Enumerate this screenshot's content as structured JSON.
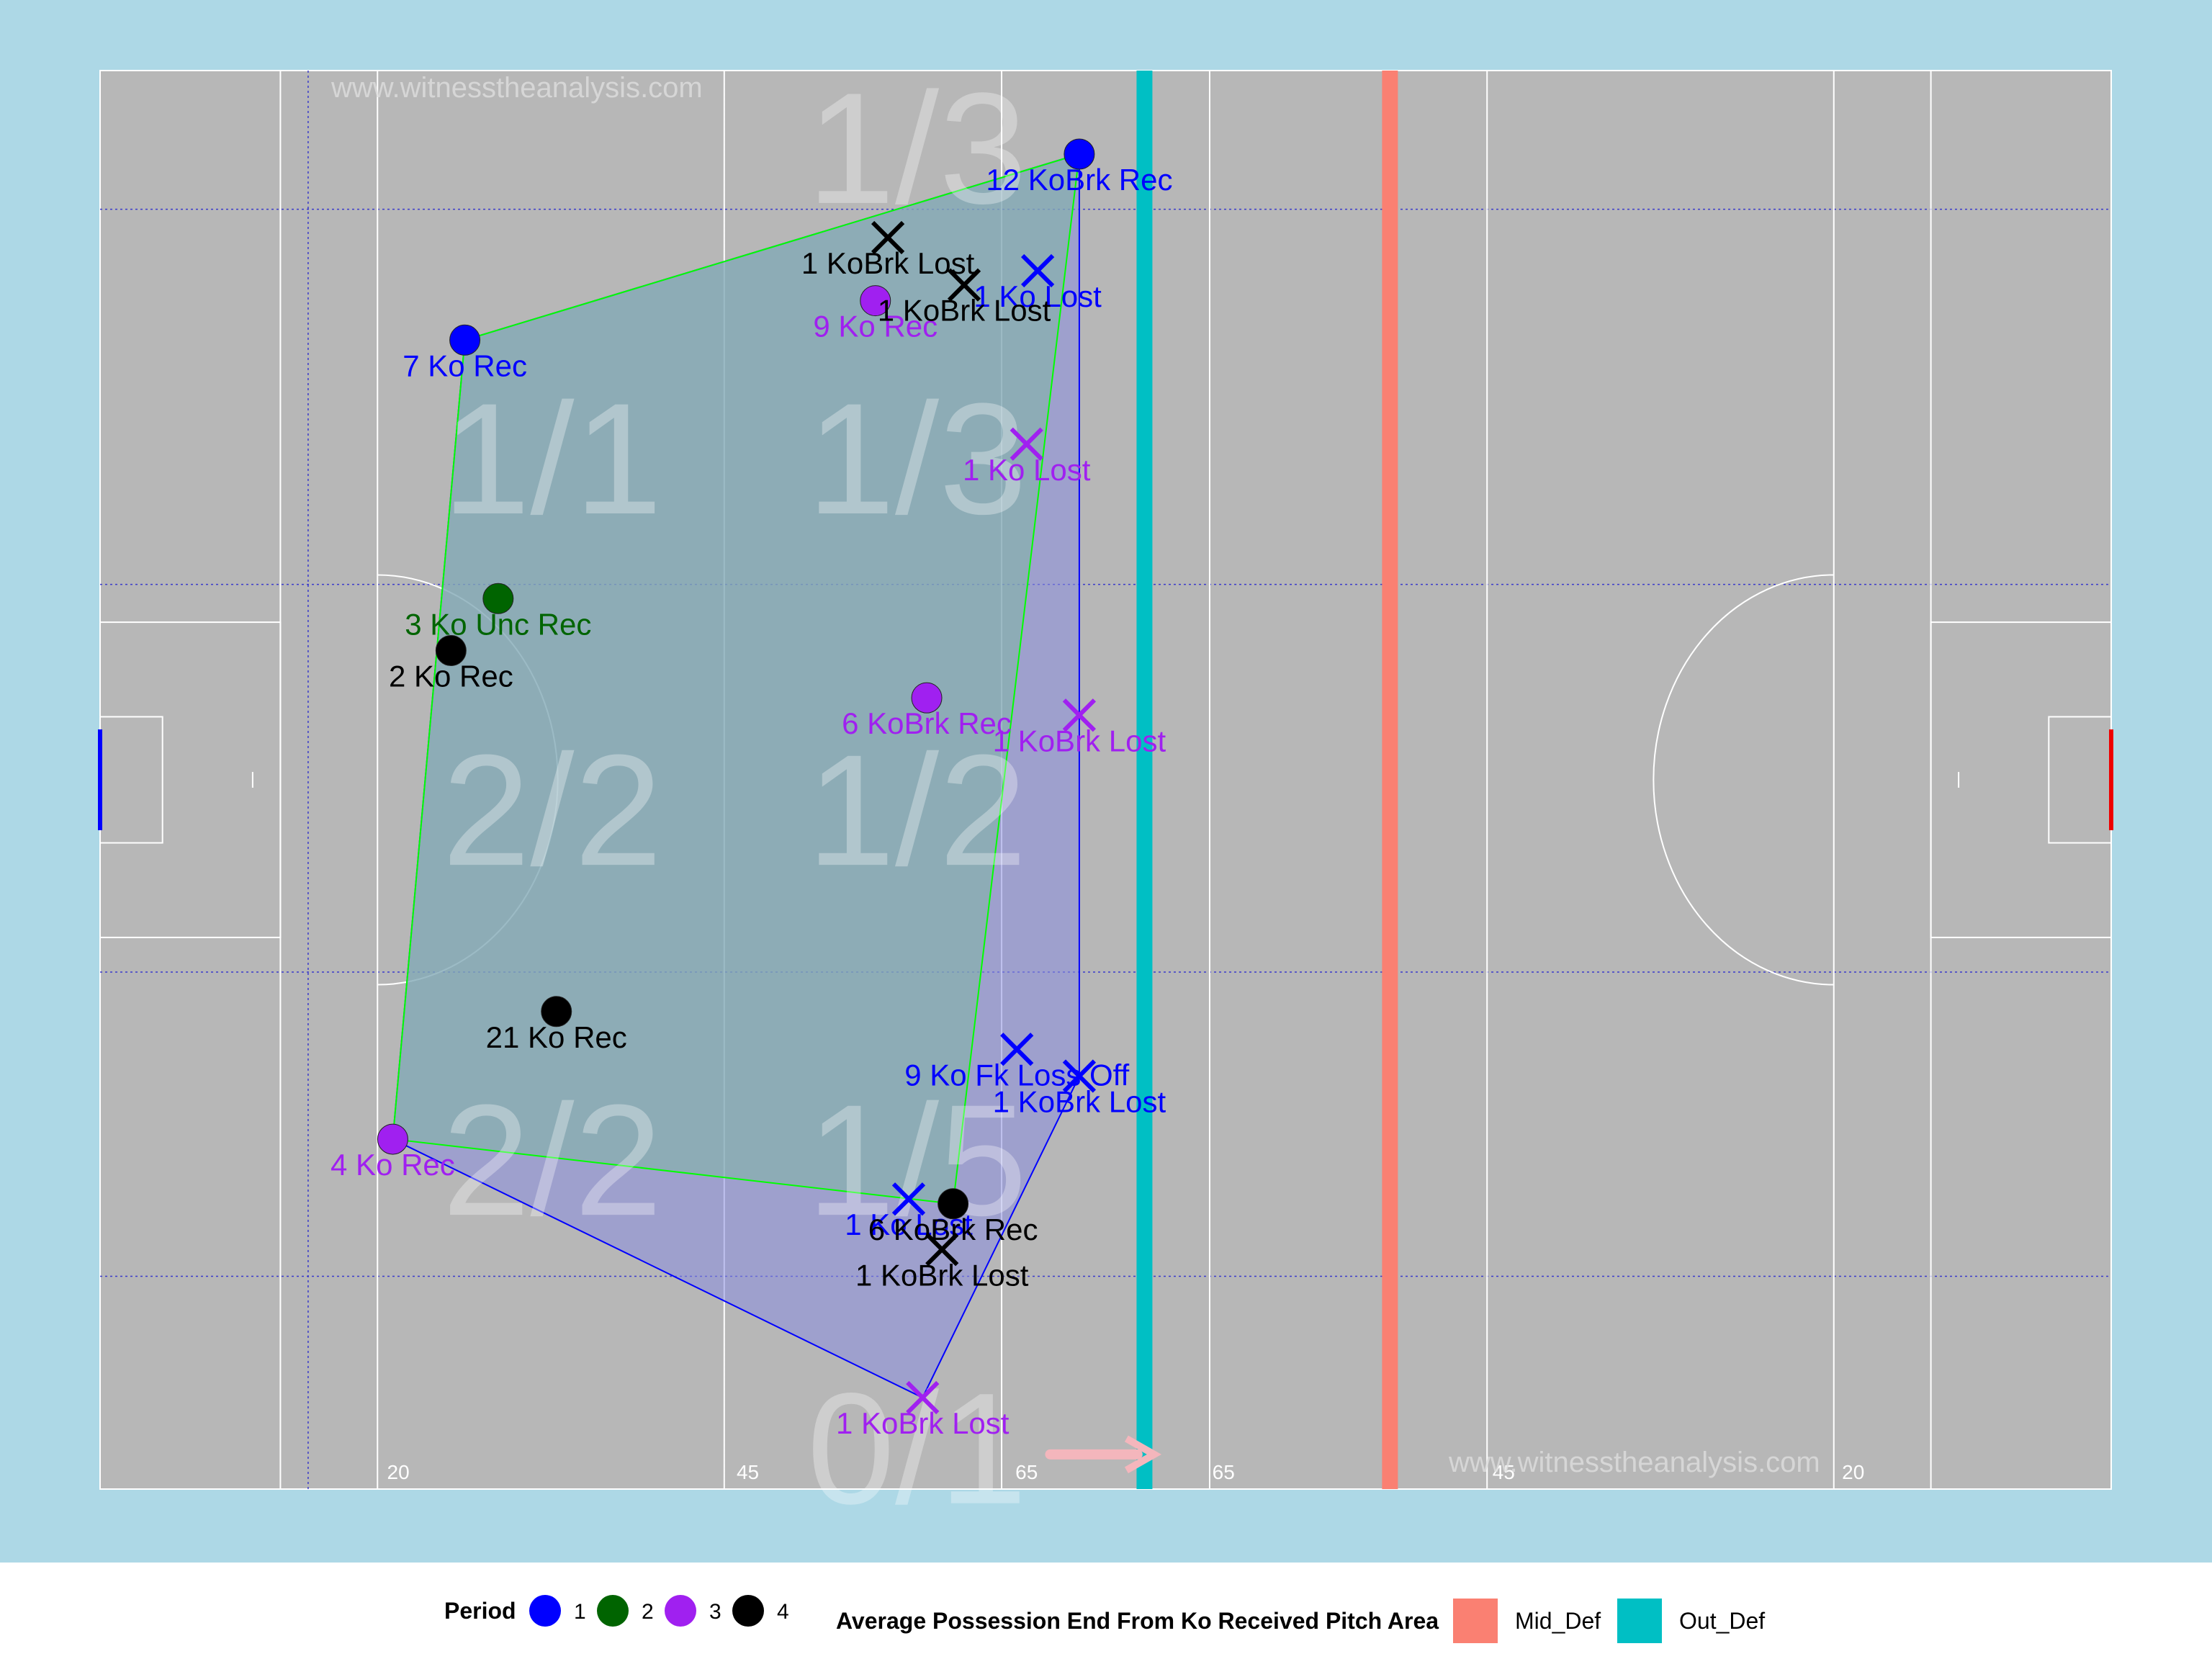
{
  "watermarks": [
    "www.witnesstheanalysis.com",
    "www.witnesstheanalysis.com"
  ],
  "colors": {
    "panel_background": "#add8e6",
    "pitch": "#b7b7b7",
    "period_1": "#0000ff",
    "period_2": "#006400",
    "period_3": "#a020f0",
    "period_4": "#000000",
    "mid_def": "#fa8072",
    "out_def": "#00bfc4",
    "hull_green_outline": "#00ff00",
    "hull_blue_outline": "#0000ff"
  },
  "chart_data": {
    "type": "scatter",
    "x_range": [
      0,
      145
    ],
    "y_range": [
      0,
      90
    ],
    "x_ticks": [
      {
        "x": 21.5,
        "label": "20"
      },
      {
        "x": 46.7,
        "label": "45"
      },
      {
        "x": 66.8,
        "label": "65"
      },
      {
        "x": 81.0,
        "label": "65"
      },
      {
        "x": 101.2,
        "label": "45"
      },
      {
        "x": 126.4,
        "label": "20"
      }
    ],
    "zone_labels": [
      {
        "x": 58.9,
        "y": 84.8,
        "label": "1/3"
      },
      {
        "x": 32.6,
        "y": 65.1,
        "label": "1/1"
      },
      {
        "x": 58.9,
        "y": 65.1,
        "label": "1/3"
      },
      {
        "x": 32.6,
        "y": 42.8,
        "label": "2/2"
      },
      {
        "x": 58.9,
        "y": 42.8,
        "label": "1/2"
      },
      {
        "x": 32.6,
        "y": 20.6,
        "label": "2/2"
      },
      {
        "x": 58.9,
        "y": 20.6,
        "label": "1/5"
      },
      {
        "x": 58.9,
        "y": 2.3,
        "label": "0/1"
      }
    ],
    "average_lines": [
      {
        "name": "Mid_Def",
        "x": 93.0,
        "color": "#fa8072"
      },
      {
        "name": "Out_Def",
        "x": 75.3,
        "color": "#00bfc4"
      }
    ],
    "points": [
      {
        "x": 70.6,
        "y": 84.7,
        "period": 1,
        "marker": "dot",
        "label": "12 KoBrk Rec"
      },
      {
        "x": 26.3,
        "y": 72.9,
        "period": 1,
        "marker": "dot",
        "label": "7 Ko Rec"
      },
      {
        "x": 67.6,
        "y": 77.3,
        "period": 1,
        "marker": "x",
        "label": "1 Ko Lost"
      },
      {
        "x": 66.1,
        "y": 27.9,
        "period": 1,
        "marker": "x",
        "label": "9 Ko Fk Loss Off"
      },
      {
        "x": 70.6,
        "y": 26.2,
        "period": 1,
        "marker": "x",
        "label": "1 KoBrk Lost"
      },
      {
        "x": 58.3,
        "y": 18.4,
        "period": 1,
        "marker": "x",
        "label": "1 Ko Lost"
      },
      {
        "x": 28.7,
        "y": 56.5,
        "period": 2,
        "marker": "dot",
        "label": "3 Ko Unc Rec"
      },
      {
        "x": 55.9,
        "y": 75.4,
        "period": 3,
        "marker": "dot",
        "label": "9 Ko Rec"
      },
      {
        "x": 66.8,
        "y": 66.3,
        "period": 3,
        "marker": "x",
        "label": "1 Ko Lost"
      },
      {
        "x": 59.6,
        "y": 50.2,
        "period": 3,
        "marker": "dot",
        "label": "6 KoBrk Rec"
      },
      {
        "x": 70.6,
        "y": 49.1,
        "period": 3,
        "marker": "x",
        "label": "1 KoBrk Lost"
      },
      {
        "x": 21.1,
        "y": 22.2,
        "period": 3,
        "marker": "dot",
        "label": "4 Ko Rec"
      },
      {
        "x": 59.3,
        "y": 5.8,
        "period": 3,
        "marker": "x",
        "label": "1 KoBrk Lost"
      },
      {
        "x": 56.8,
        "y": 79.4,
        "period": 4,
        "marker": "x",
        "label": "1 KoBrk Lost"
      },
      {
        "x": 62.3,
        "y": 76.4,
        "period": 4,
        "marker": "x",
        "label": "1 KoBrk Lost"
      },
      {
        "x": 25.3,
        "y": 53.2,
        "period": 4,
        "marker": "dot",
        "label": "2 Ko Rec"
      },
      {
        "x": 32.9,
        "y": 30.3,
        "period": 4,
        "marker": "dot",
        "label": "21 Ko Rec"
      },
      {
        "x": 61.5,
        "y": 18.1,
        "period": 4,
        "marker": "dot",
        "label": "6 KoBrk Rec"
      },
      {
        "x": 60.7,
        "y": 15.2,
        "period": 4,
        "marker": "x",
        "label": "1 KoBrk Lost"
      }
    ],
    "legend": {
      "position": "bottom",
      "period_title": "Period",
      "period_items": [
        {
          "label": "1",
          "color": "#0000ff"
        },
        {
          "label": "2",
          "color": "#006400"
        },
        {
          "label": "3",
          "color": "#a020f0"
        },
        {
          "label": "4",
          "color": "#000000"
        }
      ],
      "area_title": "Average Possession End From Ko Received Pitch Area",
      "area_items": [
        {
          "label": "Mid_Def",
          "color": "#fa8072"
        },
        {
          "label": "Out_Def",
          "color": "#00bfc4"
        }
      ]
    }
  }
}
